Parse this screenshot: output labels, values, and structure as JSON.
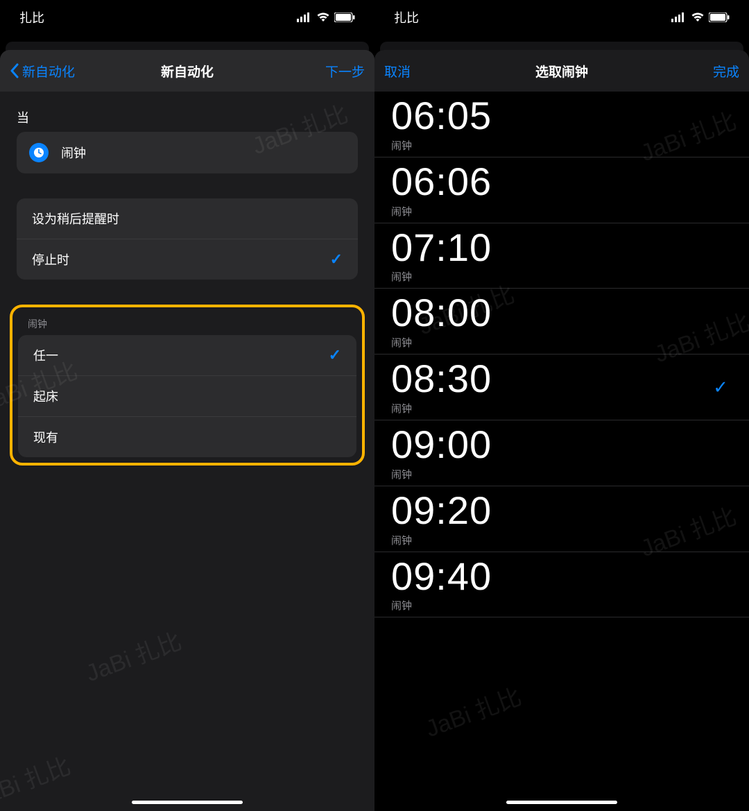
{
  "statusBar": {
    "carrier": "扎比"
  },
  "left": {
    "nav": {
      "back": "新自动化",
      "title": "新自动化",
      "next": "下一步"
    },
    "section_when": "当",
    "alarm_card_label": "闹钟",
    "trigger_options": [
      {
        "label": "设为稍后提醒时",
        "checked": false
      },
      {
        "label": "停止时",
        "checked": true
      }
    ],
    "alarm_group_header": "闹钟",
    "alarm_options": [
      {
        "label": "任一",
        "checked": true
      },
      {
        "label": "起床",
        "checked": false
      },
      {
        "label": "现有",
        "checked": false
      }
    ]
  },
  "right": {
    "nav": {
      "cancel": "取消",
      "title": "选取闹钟",
      "done": "完成"
    },
    "alarm_sub": "闹钟",
    "alarms": [
      {
        "time": "06:05",
        "checked": false
      },
      {
        "time": "06:06",
        "checked": false
      },
      {
        "time": "07:10",
        "checked": false
      },
      {
        "time": "08:00",
        "checked": false
      },
      {
        "time": "08:30",
        "checked": true
      },
      {
        "time": "09:00",
        "checked": false
      },
      {
        "time": "09:20",
        "checked": false
      },
      {
        "time": "09:40",
        "checked": false
      }
    ]
  },
  "watermark": "JaBi 扎比"
}
